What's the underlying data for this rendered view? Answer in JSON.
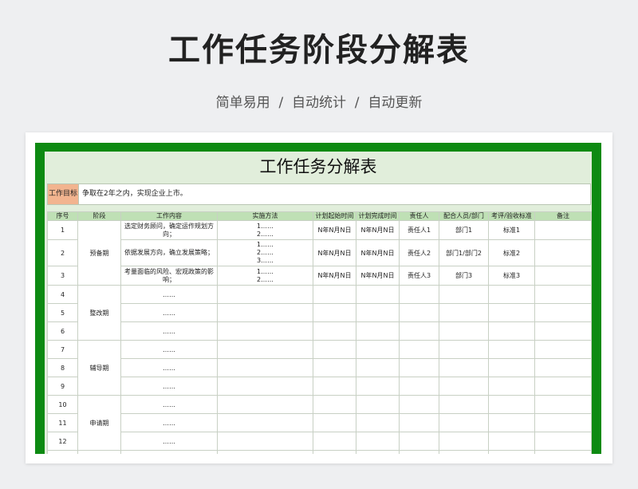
{
  "header": {
    "title": "工作任务阶段分解表",
    "subtitle": "简单易用  /  自动统计  /  自动更新"
  },
  "sheet": {
    "title": "工作任务分解表",
    "goal_label": "工作目标",
    "goal_text": "争取在2年之内，实现企业上市。",
    "columns": [
      "序号",
      "阶段",
      "工作内容",
      "实施方法",
      "计划起始时间",
      "计划完成时间",
      "责任人",
      "配合人员/部门",
      "考评/验收标准",
      "备注"
    ],
    "stages": [
      "预备期",
      "整改期",
      "辅导期",
      "申请期"
    ],
    "rows": [
      {
        "no": "1",
        "content": "选定财务顾问，确定运作规划方向；",
        "method": "1……\n2……",
        "start": "N年N月N日",
        "end": "N年N月N日",
        "owner": "责任人1",
        "dept": "部门1",
        "standard": "标准1",
        "note": ""
      },
      {
        "no": "2",
        "content": "依据发展方向，确立发展策略；",
        "method": "1……\n2……\n3……",
        "start": "N年N月N日",
        "end": "N年N月N日",
        "owner": "责任人2",
        "dept": "部门1/部门2",
        "standard": "标准2",
        "note": ""
      },
      {
        "no": "3",
        "content": "考量面临的风险、宏观政策的影响；",
        "method": "1……\n2……",
        "start": "N年N月N日",
        "end": "N年N月N日",
        "owner": "责任人3",
        "dept": "部门3",
        "standard": "标准3",
        "note": ""
      },
      {
        "no": "4",
        "content": "……"
      },
      {
        "no": "5",
        "content": "……"
      },
      {
        "no": "6",
        "content": "……"
      },
      {
        "no": "7",
        "content": "……"
      },
      {
        "no": "8",
        "content": "……"
      },
      {
        "no": "9",
        "content": "……"
      },
      {
        "no": "10",
        "content": "……"
      },
      {
        "no": "11",
        "content": "……"
      },
      {
        "no": "12",
        "content": "……"
      }
    ]
  }
}
